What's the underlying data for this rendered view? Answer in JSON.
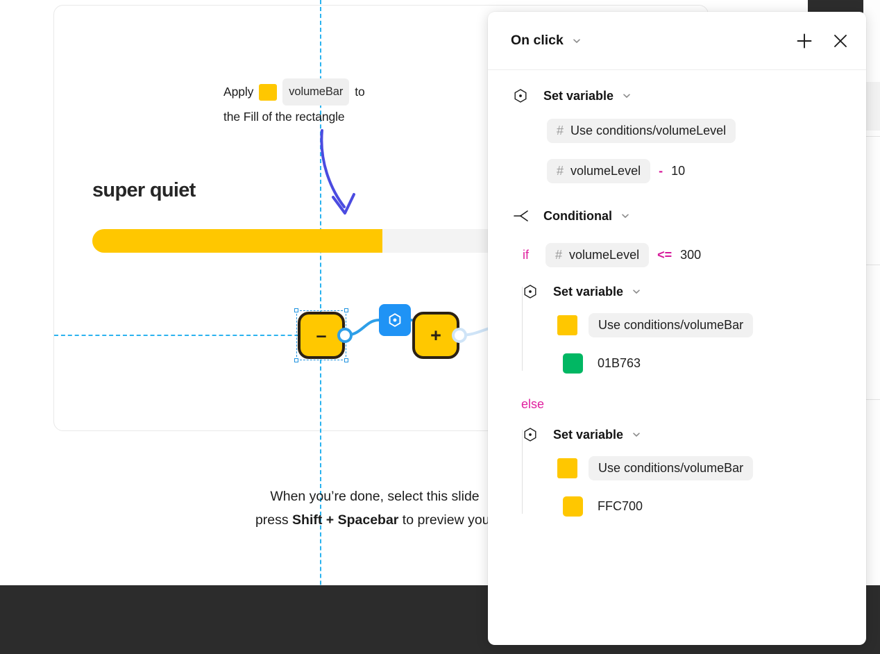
{
  "canvas": {
    "callout": {
      "prefix": "Apply",
      "swatch_color": "#FFC700",
      "chip_label": "volumeBar",
      "suffix": "to",
      "line2": "the Fill of the rectangle"
    },
    "headline": "super quiet",
    "volume_bar": {
      "fill_color": "#FFC700",
      "track_color": "#F3F3F3",
      "fill_percent": 63
    },
    "nodes": {
      "minus_label": "–",
      "plus_label": "+",
      "prototype_icon": "hexagon-node-icon"
    },
    "instruction": {
      "line1": "When you’re done, select this slide",
      "line2_prefix": "press ",
      "line2_bold": "Shift + Spacebar",
      "line2_suffix": " to preview your"
    },
    "guide_color": "#2BB3EF",
    "arrow_color": "#4B4BE0"
  },
  "panel": {
    "title": "On click",
    "title_caret": "chevron-down-icon",
    "add_label": "+",
    "close_label": "×",
    "blocks": [
      {
        "icon": "set-variable-icon",
        "title": "Set variable",
        "caret": "chevron-down-icon",
        "rows": [
          {
            "kind": "chip",
            "hash": "#",
            "label": "Use conditions/volumeLevel"
          },
          {
            "kind": "chip_expr",
            "hash": "#",
            "label": "volumeLevel",
            "op": "-",
            "value": "10"
          }
        ]
      },
      {
        "icon": "conditional-icon",
        "title": "Conditional",
        "caret": "chevron-down-icon",
        "if_keyword": "if",
        "condition": {
          "hash": "#",
          "label": "volumeLevel",
          "op": "<=",
          "value": "300"
        },
        "if_branch": {
          "icon": "set-variable-icon",
          "title": "Set variable",
          "caret": "chevron-down-icon",
          "rows": [
            {
              "kind": "swatch_chip",
              "swatch": "#FFC700",
              "label": "Use conditions/volumeBar"
            },
            {
              "kind": "swatch_value",
              "swatch": "#01B763",
              "label": "01B763"
            }
          ]
        },
        "else_keyword": "else",
        "else_branch": {
          "icon": "set-variable-icon",
          "title": "Set variable",
          "caret": "chevron-down-icon",
          "rows": [
            {
              "kind": "swatch_chip",
              "swatch": "#FFC700",
              "label": "Use conditions/volumeBar"
            },
            {
              "kind": "swatch_value",
              "swatch": "#FFC700",
              "label": "FFC700"
            }
          ]
        }
      }
    ]
  }
}
